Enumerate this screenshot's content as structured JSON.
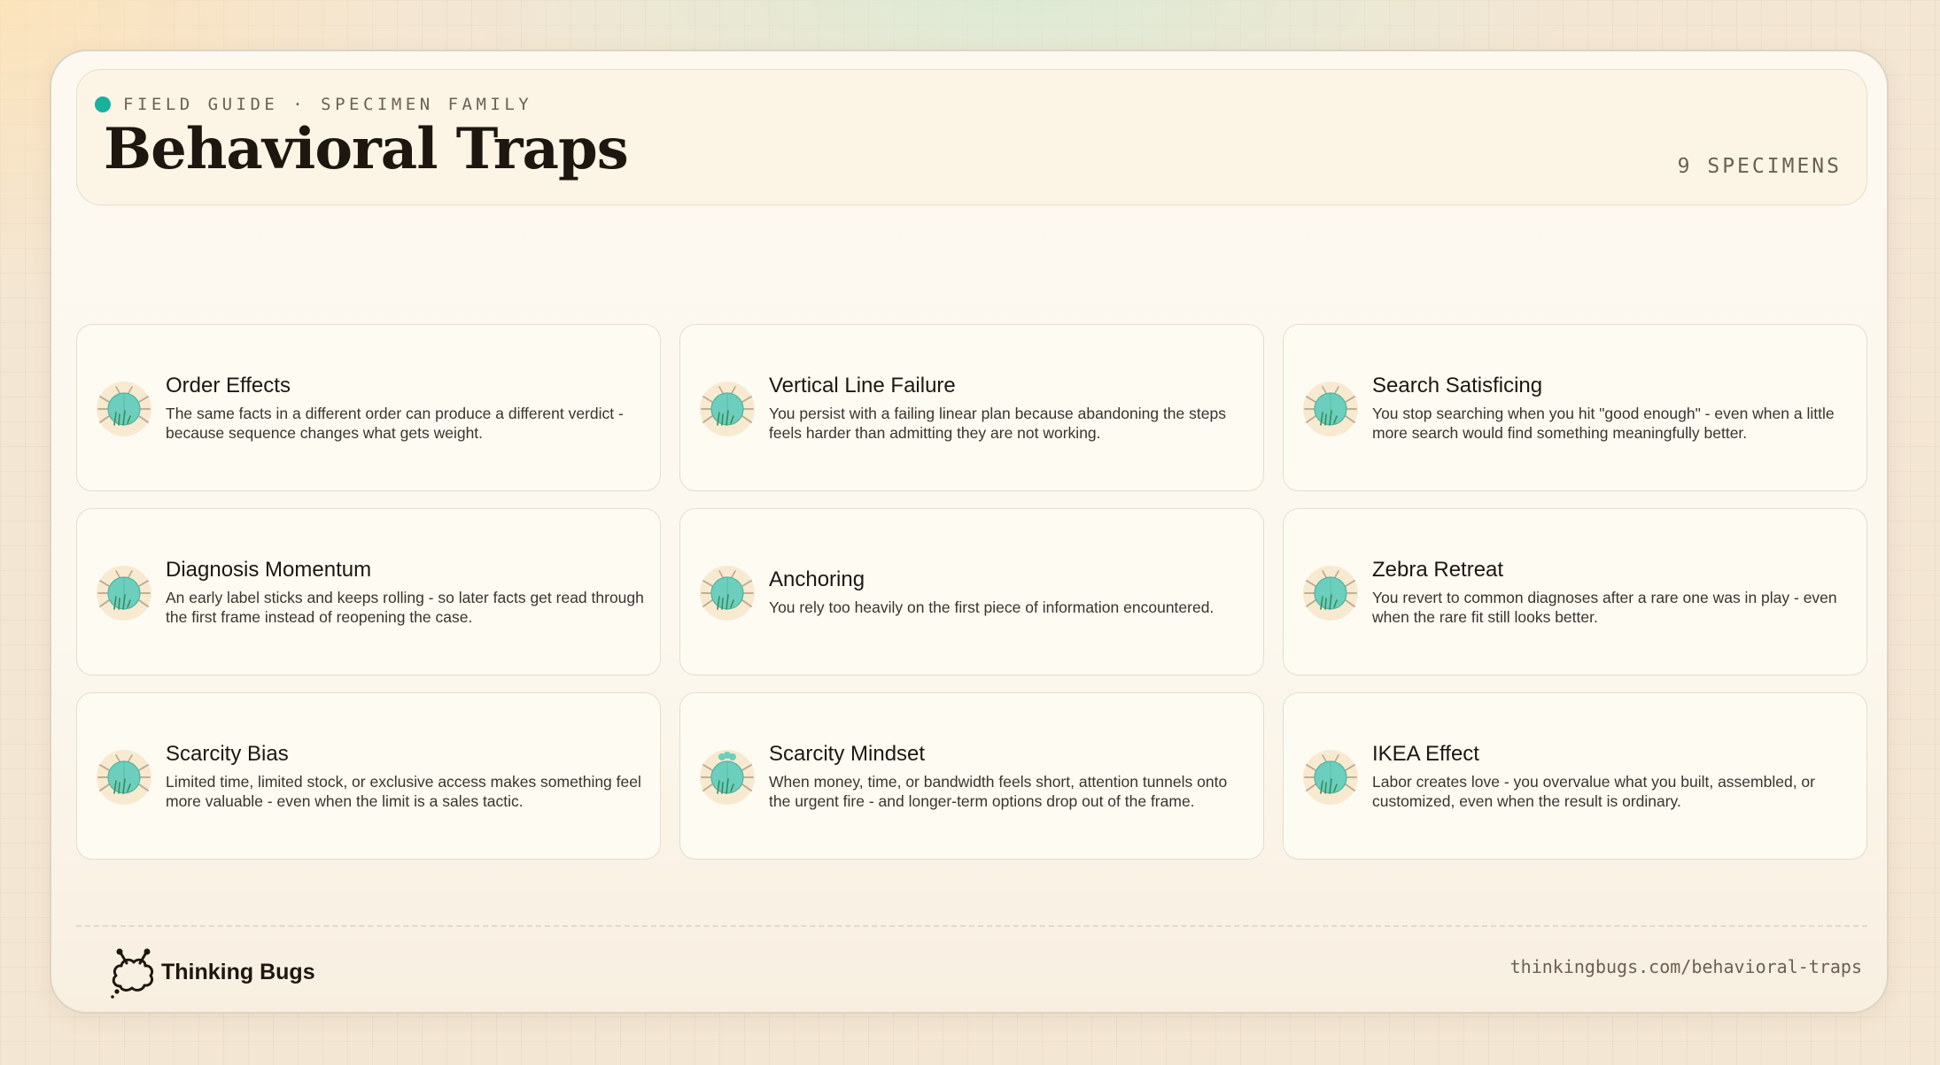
{
  "header": {
    "eyebrow": "FIELD GUIDE · SPECIMEN FAMILY",
    "title": "Behavioral Traps",
    "count": "9 SPECIMENS"
  },
  "specimens": [
    {
      "title": "Order Effects",
      "description": "The same facts in a different order can produce a different verdict - because sequence changes what gets weight.",
      "icon": "bug-icon"
    },
    {
      "title": "Vertical Line Failure",
      "description": "You persist with a failing linear plan because abandoning the steps feels harder than admitting they are not working.",
      "icon": "bug-icon"
    },
    {
      "title": "Search Satisficing",
      "description": "You stop searching when you hit \"good enough\" - even when a little more search would find something meaningfully better.",
      "icon": "bug-icon"
    },
    {
      "title": "Diagnosis Momentum",
      "description": "An early label sticks and keeps rolling - so later facts get read through the first frame instead of reopening the case.",
      "icon": "bug-icon"
    },
    {
      "title": "Anchoring",
      "description": "You rely too heavily on the first piece of information encountered.",
      "icon": "bug-icon"
    },
    {
      "title": "Zebra Retreat",
      "description": "You revert to common diagnoses after a rare one was in play - even when the rare fit still looks better.",
      "icon": "bug-icon"
    },
    {
      "title": "Scarcity Bias",
      "description": "Limited time, limited stock, or exclusive access makes something feel more valuable - even when the limit is a sales tactic.",
      "icon": "bug-icon"
    },
    {
      "title": "Scarcity Mindset",
      "description": "When money, time, or bandwidth feels short, attention tunnels onto the urgent fire - and longer-term options drop out of the frame.",
      "icon": "bug-icon"
    },
    {
      "title": "IKEA Effect",
      "description": "Labor creates love - you overvalue what you built, assembled, or customized, even when the result is ordinary.",
      "icon": "bug-icon"
    }
  ],
  "footer": {
    "brand": "Thinking Bugs",
    "brand_icon": "thinking-bug-logo-icon",
    "url": "thinkingbugs.com/behavioral-traps"
  },
  "colors": {
    "accent": "#19b09d",
    "bug_body": "#6ccfbd",
    "bug_halo": "#f6e4c6",
    "bug_legs": "#b9a98c",
    "bug_grass": "#3d8a5e"
  }
}
